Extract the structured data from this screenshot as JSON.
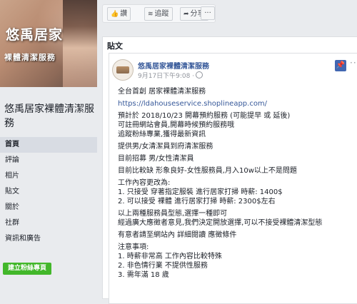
{
  "page": {
    "cover_title": "悠禹居家",
    "cover_subtitle": "裸體清潔服務",
    "name": "悠禹居家裸體清潔服務"
  },
  "nav": {
    "items": [
      "首頁",
      "評論",
      "相片",
      "貼文",
      "關於",
      "社群",
      "資訊和廣告"
    ],
    "create_page_button": "建立粉絲專頁"
  },
  "toolbar": {
    "like_label": "讚",
    "follow_label": "追蹤",
    "share_label": "分享",
    "more_label": "···"
  },
  "posts_section": {
    "header": "貼文"
  },
  "post": {
    "author": "悠禹居家裸體清潔服務",
    "time": "9月17日下午9:08 ·",
    "more": "···",
    "lines": [
      "全台首創 居家裸體清潔服務",
      "https://ldahouseservice.shoplineapp.com/",
      "預計於 2018/10/23 開幕預約服務 (可能提早 或 延後)",
      "可註冊網站會員,開幕時候預約服務哦",
      "追蹤粉絲專業,獲得最新資訊",
      "提供男/女清潔員到府清潔服務",
      "目前招募 男/女性清潔員",
      "目前比較缺 形象良好-女性服務員,月入10w以上不是問題",
      "工作內容更改為:",
      "1. 只接受 穿著指定服裝 進行居家打掃 時薪: 1400$",
      "2. 可以接受 裸體 進行居家打掃 時薪: 2300$左右",
      "以上兩種服務員型態,選擇一種即可",
      "經過廣大應徵者意見,我們決定開放選擇,可以不接受裸體清潔型態",
      "有意者請至網站內 詳細閱讀 應徵條件",
      "注意事項:",
      "1. 時薪非常高 工作內容比較特殊",
      "2. 非色情行業 不提供性服務",
      "3. 需年滿 18 歲"
    ]
  },
  "colors": {
    "link": "#365899",
    "create_button": "#42b72a",
    "pin": "#4267b2"
  }
}
